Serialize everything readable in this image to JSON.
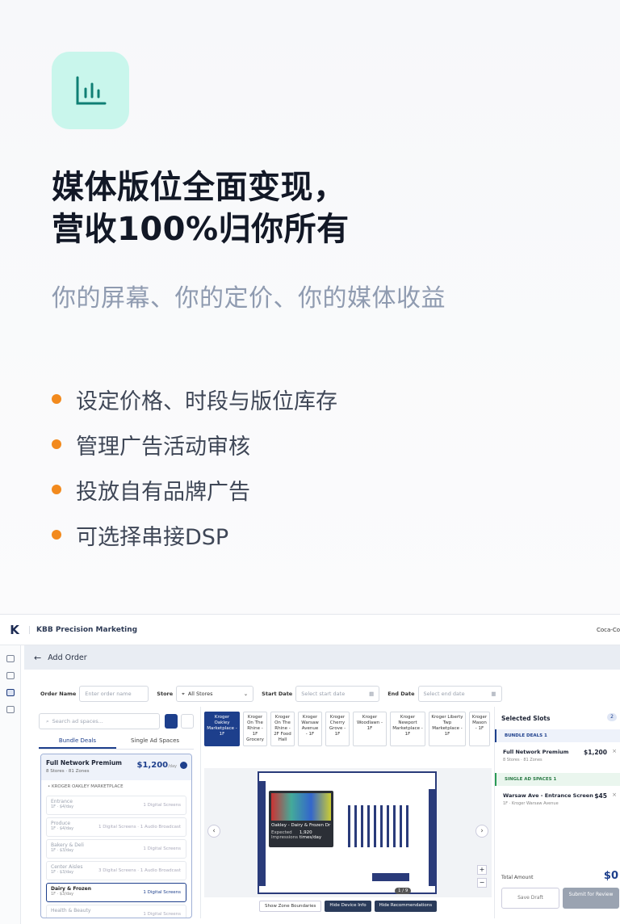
{
  "hero": {
    "title_line1": "媒体版位全面变现，",
    "title_line2": "营收100%归你所有",
    "subtitle": "你的屏幕、你的定价、你的媒体收益",
    "bullets": [
      "设定价格、时段与版位库存",
      "管理广告活动审核",
      "投放自有品牌广告",
      "可选择串接DSP"
    ],
    "icon": "bar-chart-icon",
    "accent": "#f28a1e"
  },
  "app": {
    "logo": "K",
    "brand": "KBB Precision Marketing",
    "user": "Coca-Co",
    "page_title": "Add Order",
    "filters": {
      "order_name_label": "Order Name",
      "order_name_placeholder": "Enter order name",
      "store_label": "Store",
      "store_value": "All Stores",
      "start_label": "Start Date",
      "start_placeholder": "Select start date",
      "end_label": "End Date",
      "end_placeholder": "Select end date"
    },
    "left": {
      "search_placeholder": "Search ad spaces...",
      "tabs": [
        "Bundle Deals",
        "Single Ad Spaces"
      ],
      "bundle": {
        "name": "Full Network Premium",
        "meta": "8 Stores · 81 Zones",
        "price": "$1,200",
        "price_unit": "/day",
        "section": "• KROGER OAKLEY MARKETPLACE",
        "zones": [
          {
            "name": "Entrance",
            "meta": "1F · $4/day",
            "screens": "1 Digital Screens"
          },
          {
            "name": "Produce",
            "meta": "1F · $4/day",
            "screens": "1 Digital Screens · 1 Audio Broadcast"
          },
          {
            "name": "Bakery & Deli",
            "meta": "1F · $3/day",
            "screens": "1 Digital Screens"
          },
          {
            "name": "Center Aisles",
            "meta": "1F · $3/day",
            "screens": "3 Digital Screens · 1 Audio Broadcast"
          },
          {
            "name": "Dairy & Frozen",
            "meta": "1F · $3/day",
            "screens": "1 Digital Screens"
          },
          {
            "name": "Health & Beauty",
            "meta": "",
            "screens": "1 Digital Screens"
          }
        ]
      }
    },
    "stores": [
      "Kroger Oakley Marketplace - 1F",
      "Kroger On The Rhine - 1F Grocery",
      "Kroger On The Rhine - 2F Food Hall",
      "Kroger Warsaw Avenue - 1F",
      "Kroger Cherry Grove - 1F",
      "Kroger Woodlawn - 1F",
      "Kroger Newport Marketplace - 1F",
      "Kroger Liberty Twp Marketplace - 1F",
      "Kroger Mason - 1F"
    ],
    "map": {
      "tooltip_title": "Oakley - Dairy & Frozen Dr",
      "tooltip_label": "Expected Impressions",
      "tooltip_value": "1,920 times/day",
      "pager": "1 / 9",
      "buttons": [
        "Show Zone Boundaries",
        "Hide Device Info",
        "Hide Recommendations"
      ]
    },
    "right": {
      "title": "Selected Slots",
      "count": "2",
      "bundle_section": "BUNDLE DEALS",
      "bundle_count": "1",
      "bundle_item": "Full Network Premium",
      "bundle_meta": "8 Stores · 81 Zones",
      "bundle_price": "$1,200",
      "single_section": "SINGLE AD SPACES",
      "single_count": "1",
      "single_item": "Warsaw Ave - Entrance Screen",
      "single_meta": "1F · Kroger Warsaw Avenue",
      "single_price": "$45",
      "total_label": "Total Amount",
      "total_value": "$0",
      "save": "Save Draft",
      "submit": "Submit for Review"
    }
  }
}
